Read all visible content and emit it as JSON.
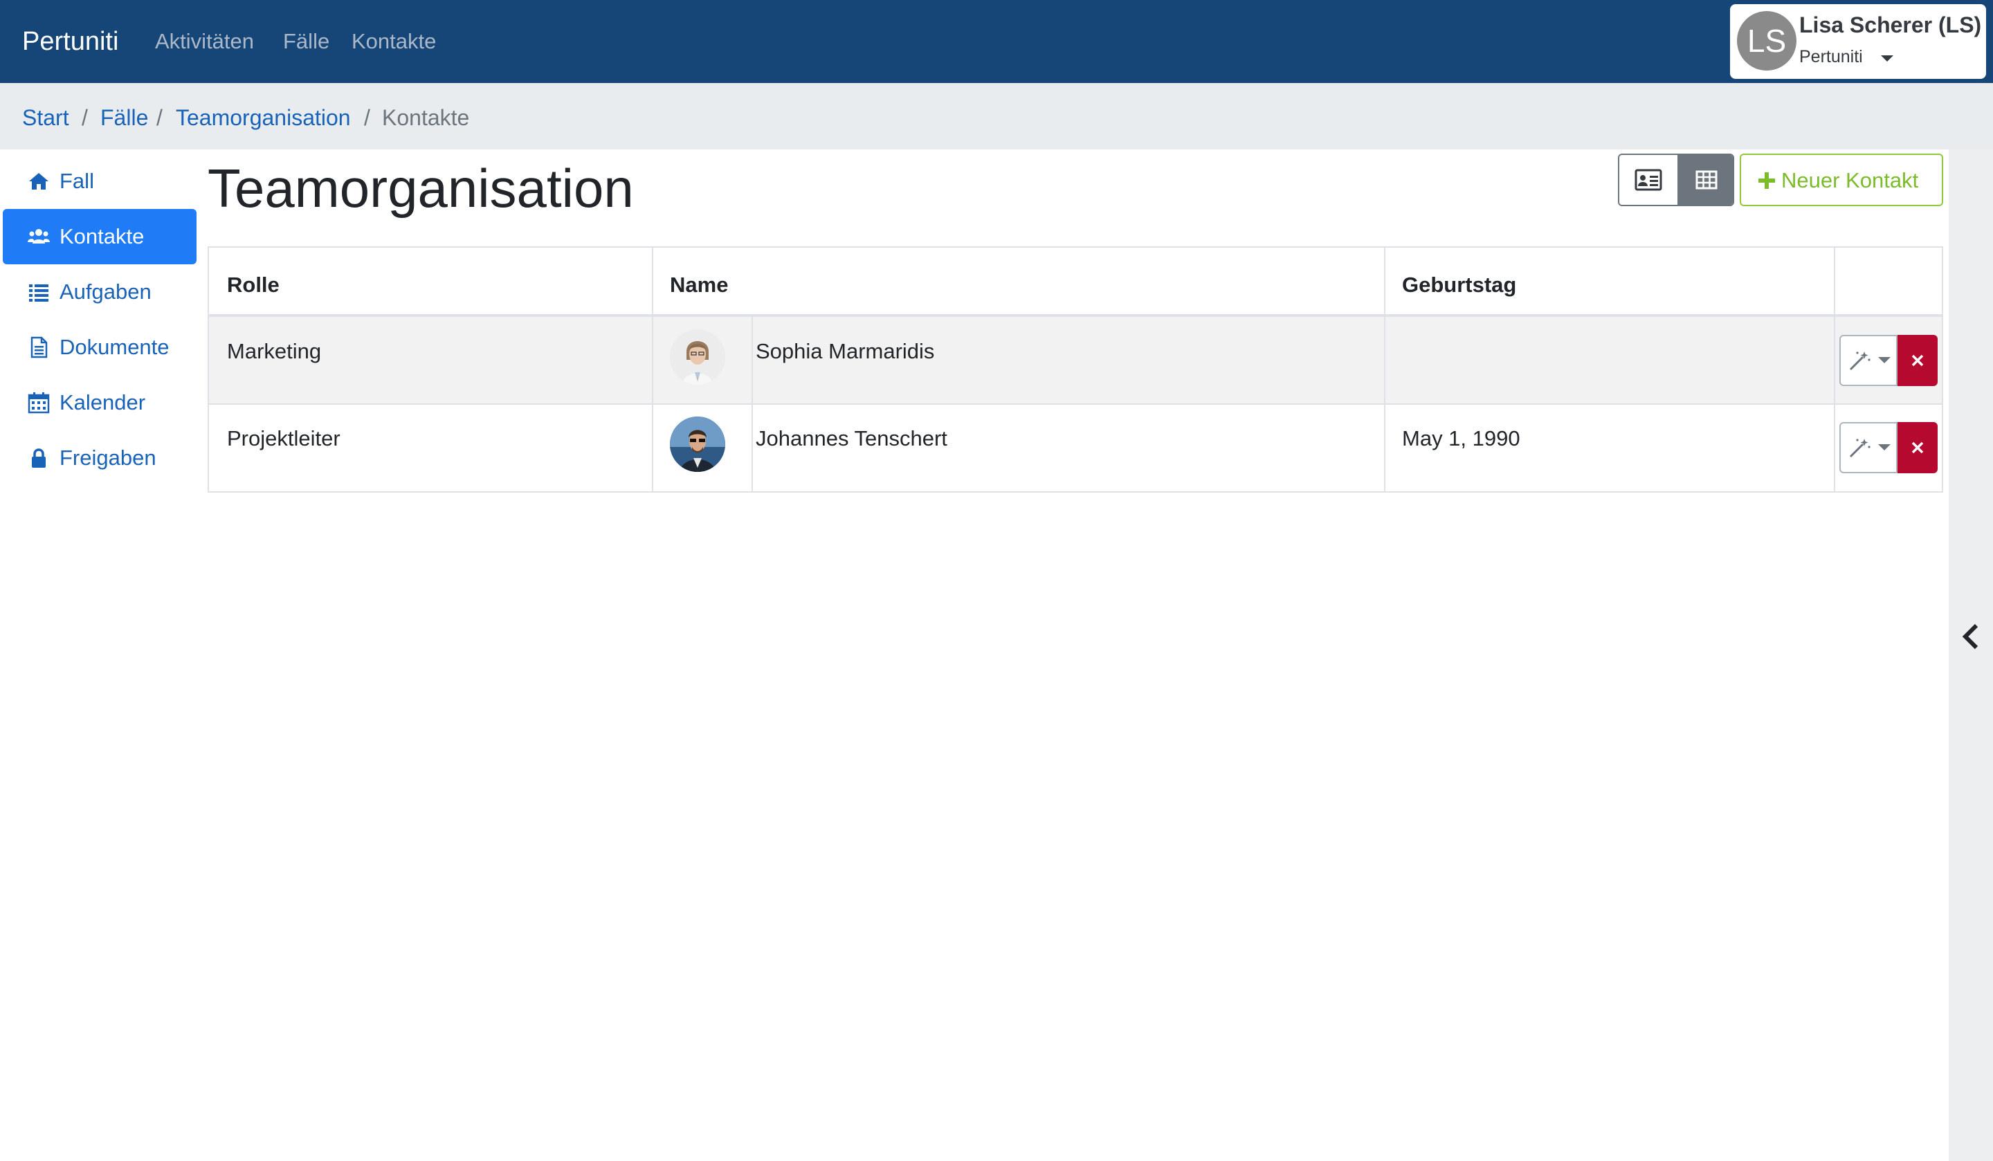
{
  "navbar": {
    "brand": "Pertuniti",
    "links": [
      "Aktivitäten",
      "Fälle",
      "Kontakte"
    ],
    "user": {
      "initials": "LS",
      "name": "Lisa Scherer (LS)",
      "org": "Pertuniti"
    }
  },
  "breadcrumb": {
    "items": [
      "Start",
      "Fälle",
      "Teamorganisation",
      "Kontakte"
    ],
    "separator": "/"
  },
  "sidebar": {
    "items": [
      {
        "label": "Fall",
        "icon": "home-icon",
        "active": false
      },
      {
        "label": "Kontakte",
        "icon": "users-icon",
        "active": true
      },
      {
        "label": "Aufgaben",
        "icon": "list-icon",
        "active": false
      },
      {
        "label": "Dokumente",
        "icon": "document-icon",
        "active": false
      },
      {
        "label": "Kalender",
        "icon": "calendar-icon",
        "active": false
      },
      {
        "label": "Freigaben",
        "icon": "lock-icon",
        "active": false
      }
    ]
  },
  "main": {
    "title": "Teamorganisation",
    "new_contact_label": "Neuer Kontakt",
    "view_toggle": {
      "options": [
        "card-view",
        "table-view"
      ],
      "selected": "table-view"
    },
    "table": {
      "headers": [
        "Rolle",
        "Name",
        "Geburtstag"
      ],
      "rows": [
        {
          "role": "Marketing",
          "name": "Sophia Marmaridis",
          "birthday": ""
        },
        {
          "role": "Projektleiter",
          "name": "Johannes Tenschert",
          "birthday": "May 1, 1990"
        }
      ]
    }
  },
  "colors": {
    "navbar": "#164677",
    "link": "#1862b7",
    "active": "#1f7cf6",
    "success": "#7cbb2a",
    "danger": "#b5092f"
  }
}
